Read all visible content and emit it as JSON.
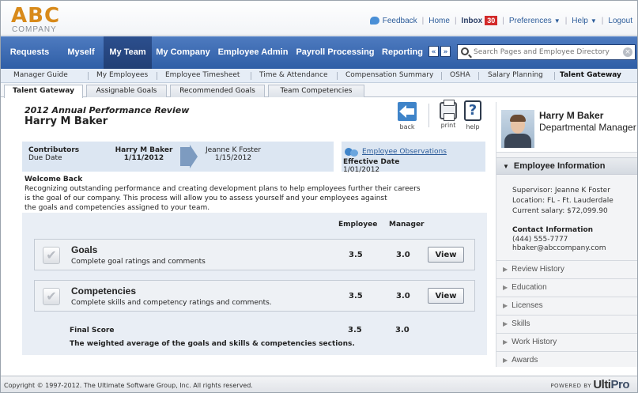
{
  "header": {
    "logo_text": "ABC",
    "logo_sub": "COMPANY",
    "links": {
      "feedback": "Feedback",
      "home": "Home",
      "inbox": "Inbox",
      "inbox_count": "30",
      "preferences": "Preferences",
      "help": "Help",
      "logout": "Logout"
    }
  },
  "nav": {
    "items": [
      {
        "label": "Requests"
      },
      {
        "label": "Myself"
      },
      {
        "label": "My Team"
      },
      {
        "label": "My Company"
      },
      {
        "label": "Employee Admin"
      },
      {
        "label": "Payroll Processing"
      },
      {
        "label": "Reporting"
      }
    ],
    "active": "My Team",
    "arrow_left": "«",
    "arrow_right": "»",
    "search_placeholder": "Search Pages and Employee Directory",
    "search_clear": "×"
  },
  "subnav": {
    "items": [
      {
        "label": "Manager Guide"
      },
      {
        "label": "My Employees"
      },
      {
        "label": "Employee Timesheet"
      },
      {
        "label": "Time & Attendance"
      },
      {
        "label": "Compensation Summary"
      },
      {
        "label": "OSHA"
      },
      {
        "label": "Salary Planning"
      },
      {
        "label": "Talent Gateway"
      }
    ],
    "active": "Talent Gateway"
  },
  "tabs": {
    "items": [
      {
        "label": "Talent Gateway"
      },
      {
        "label": "Assignable Goals"
      },
      {
        "label": "Recommended Goals"
      },
      {
        "label": "Team Competencies"
      }
    ],
    "active": "Talent Gateway"
  },
  "review": {
    "title": "2012 Annual Performance Review",
    "employee_name": "Harry M Baker",
    "tools": {
      "back": "back",
      "print": "print",
      "help": "help",
      "help_glyph": "?"
    },
    "contributors_label": "Contributors",
    "due_date_label": "Due Date",
    "contributor_1": "Harry M Baker",
    "contributor_1_date": "1/11/2012",
    "contributor_2": "Jeanne K Foster",
    "contributor_2_date": "1/15/2012",
    "observations_link": "Employee Observations",
    "effective_date_label": "Effective Date",
    "effective_date": "1/01/2012",
    "welcome_heading": "Welcome Back",
    "welcome_line_1": "Recognizing outstanding performance and creating development plans to help employees further their careers",
    "welcome_line_2": "is the goal of our company. This process will allow you to  assess yourself and your employees against",
    "welcome_line_3": "the goals and competencies assigned to your team.",
    "col_employee": "Employee",
    "col_manager": "Manager",
    "check_glyph": "✔",
    "sections": [
      {
        "title": "Goals",
        "description": "Complete goal ratings and comments",
        "employee": "3.5",
        "manager": "3.0",
        "button": "View"
      },
      {
        "title": "Competencies",
        "description": "Complete skills and competency ratings and comments.",
        "employee": "3.5",
        "manager": "3.0",
        "button": "View"
      }
    ],
    "final": {
      "title": "Final Score",
      "description": "The weighted average of the goals and skills & competencies sections.",
      "employee": "3.5",
      "manager": "3.0"
    }
  },
  "panel": {
    "name": "Harry M Baker",
    "title": "Departmental Manager",
    "section_title": "Employee Information",
    "supervisor": "Supervisor: Jeanne K Foster",
    "location": "Location: FL - Ft. Lauderdale",
    "salary": "Current salary: $72,099.90",
    "contact_heading": "Contact Information",
    "phone": "(444) 555-7777",
    "email": "hbaker@abccompany.com",
    "accordions": [
      {
        "label": "Review History"
      },
      {
        "label": "Education"
      },
      {
        "label": "Licenses"
      },
      {
        "label": "Skills"
      },
      {
        "label": "Work History"
      },
      {
        "label": "Awards"
      }
    ]
  },
  "footer": {
    "copyright": "Copyright © 1997-2012. The Ultimate Software Group, Inc. All rights reserved.",
    "powered_by": "POWERED BY",
    "brand_a": "Ulti",
    "brand_b": "Pro"
  },
  "colors": {
    "nav_blue": "#2f5ea6",
    "accent_orange": "#d88a1a",
    "badge_red": "#d22a2a",
    "link_blue": "#2c5c9a"
  }
}
